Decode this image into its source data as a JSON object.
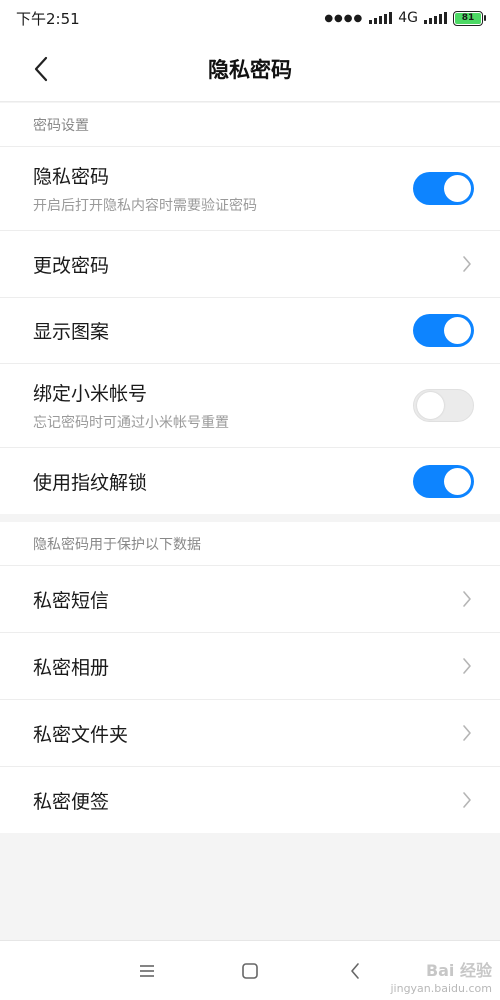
{
  "status": {
    "time": "下午2:51",
    "network": "4G",
    "battery": "81"
  },
  "header": {
    "title": "隐私密码"
  },
  "section1": {
    "header": "密码设置",
    "rows": [
      {
        "title": "隐私密码",
        "subtitle": "开启后打开隐私内容时需要验证密码",
        "control": "toggle",
        "on": true
      },
      {
        "title": "更改密码",
        "control": "chevron"
      },
      {
        "title": "显示图案",
        "control": "toggle",
        "on": true
      },
      {
        "title": "绑定小米帐号",
        "subtitle": "忘记密码时可通过小米帐号重置",
        "control": "toggle",
        "on": false
      },
      {
        "title": "使用指纹解锁",
        "control": "toggle",
        "on": true
      }
    ]
  },
  "section2": {
    "header": "隐私密码用于保护以下数据",
    "rows": [
      {
        "title": "私密短信",
        "control": "chevron"
      },
      {
        "title": "私密相册",
        "control": "chevron"
      },
      {
        "title": "私密文件夹",
        "control": "chevron"
      },
      {
        "title": "私密便签",
        "control": "chevron"
      }
    ]
  },
  "watermark": {
    "main": "Bai 经验",
    "sub": "jingyan.baidu.com"
  },
  "colors": {
    "accent": "#0d84ff",
    "toggle_off": "#ebebeb"
  }
}
